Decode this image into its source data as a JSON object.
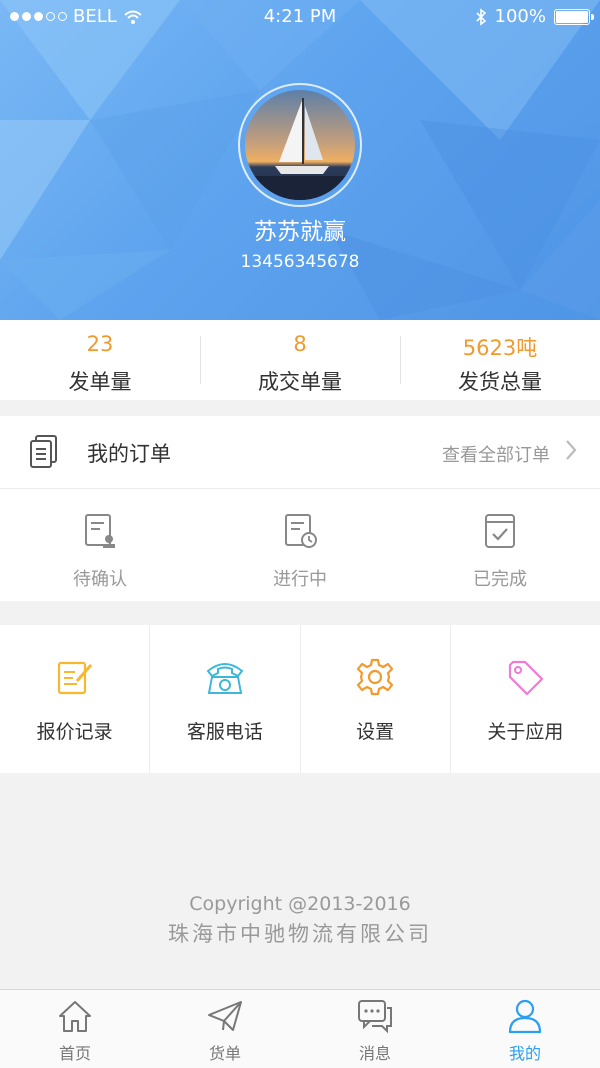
{
  "status_bar": {
    "carrier": "BELL",
    "time": "4:21 PM",
    "battery": "100%"
  },
  "profile": {
    "name": "苏苏就赢",
    "phone": "13456345678"
  },
  "stats": [
    {
      "value": "23",
      "label": "发单量"
    },
    {
      "value": "8",
      "label": "成交单量"
    },
    {
      "value": "5623吨",
      "label": "发货总量"
    }
  ],
  "orders": {
    "title": "我的订单",
    "view_all": "查看全部订单",
    "tabs": [
      {
        "label": "待确认",
        "icon": "doc-stamp-icon"
      },
      {
        "label": "进行中",
        "icon": "doc-clock-icon"
      },
      {
        "label": "已完成",
        "icon": "doc-check-icon"
      }
    ]
  },
  "services": [
    {
      "label": "报价记录",
      "icon": "quote-edit-icon",
      "color": "#f5b82e"
    },
    {
      "label": "客服电话",
      "icon": "telephone-icon",
      "color": "#3fb8d8"
    },
    {
      "label": "设置",
      "icon": "gear-icon",
      "color": "#f29a2e"
    },
    {
      "label": "关于应用",
      "icon": "tag-icon",
      "color": "#f07ad8"
    }
  ],
  "footer": {
    "copyright": "Copyright  @2013-2016",
    "company": "珠海市中驰物流有限公司"
  },
  "tabbar": [
    {
      "label": "首页",
      "icon": "home-icon"
    },
    {
      "label": "货单",
      "icon": "paper-plane-icon"
    },
    {
      "label": "消息",
      "icon": "chat-icon"
    },
    {
      "label": "我的",
      "icon": "user-icon",
      "active": true
    }
  ],
  "colors": {
    "accent": "#2b9ff0",
    "stat_number": "#f29a2e",
    "header_blue": "#5da3ee"
  }
}
